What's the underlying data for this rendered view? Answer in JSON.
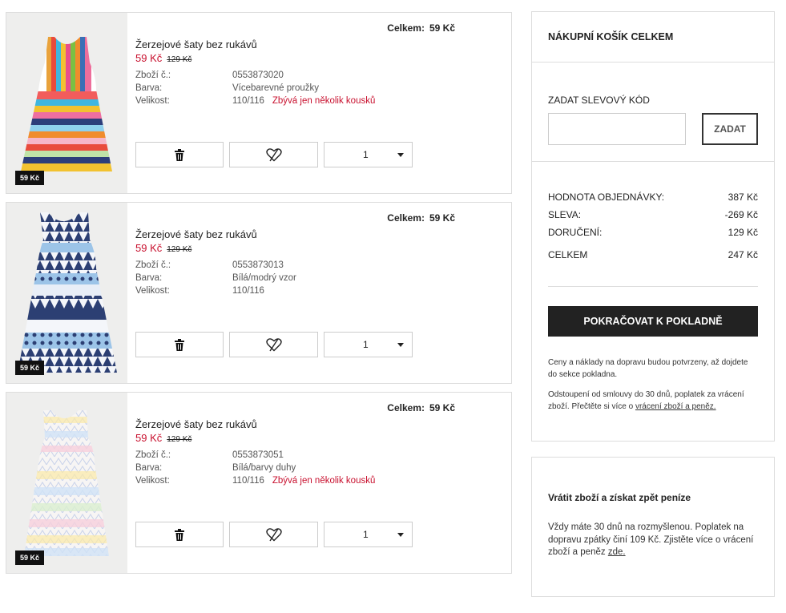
{
  "cart_items": [
    {
      "name": "Žerzejové šaty bez rukávů",
      "price": "59 Kč",
      "old_price": "129 Kč",
      "total_label": "Celkem:",
      "total_value": "59 Kč",
      "tag_price": "59 Kč",
      "article_label": "Zboží č.:",
      "article_value": "0553873020",
      "color_label": "Barva:",
      "color_value": "Vícebarevné proužky",
      "size_label": "Velikost:",
      "size_value": "110/116",
      "stock_warning": "Zbývá jen několik kousků",
      "quantity": "1"
    },
    {
      "name": "Žerzejové šaty bez rukávů",
      "price": "59 Kč",
      "old_price": "129 Kč",
      "total_label": "Celkem:",
      "total_value": "59 Kč",
      "tag_price": "59 Kč",
      "article_label": "Zboží č.:",
      "article_value": "0553873013",
      "color_label": "Barva:",
      "color_value": "Bílá/modrý vzor",
      "size_label": "Velikost:",
      "size_value": "110/116",
      "stock_warning": "",
      "quantity": "1"
    },
    {
      "name": "Žerzejové šaty bez rukávů",
      "price": "59 Kč",
      "old_price": "129 Kč",
      "total_label": "Celkem:",
      "total_value": "59 Kč",
      "tag_price": "59 Kč",
      "article_label": "Zboží č.:",
      "article_value": "0553873051",
      "color_label": "Barva:",
      "color_value": "Bílá/barvy duhy",
      "size_label": "Velikost:",
      "size_value": "110/116",
      "stock_warning": "Zbývá jen několik kousků",
      "quantity": "1"
    }
  ],
  "summary": {
    "title": "NÁKUPNÍ KOŠÍK CELKEM",
    "discount_label": "ZADAT SLEVOVÝ KÓD",
    "discount_placeholder": "",
    "discount_button": "ZADAT",
    "order_value_label": "HODNOTA OBJEDNÁVKY:",
    "order_value": "387 Kč",
    "discount_row_label": "SLEVA:",
    "discount_row_value": "-269 Kč",
    "delivery_label": "DORUČENÍ:",
    "delivery_value": "129 Kč",
    "total_label": "CELKEM",
    "total_value": "247 Kč",
    "checkout_button": "POKRAČOVAT K POKLADNĚ",
    "note1": "Ceny a náklady na dopravu budou potvrzeny, až dojdete do sekce pokladna.",
    "note2_text": "Odstoupení od smlouvy do 30 dnů, poplatek za vrácení zboží. Přečtěte si více o",
    "note2_link": "vrácení zboží a peněz."
  },
  "returns": {
    "title": "Vrátit zboží a získat zpět peníze",
    "text": "Vždy máte 30 dnů na rozmyšlenou. Poplatek na dopravu zpátky činí 109 Kč. Zjistěte více o vrácení zboží a peněz",
    "link": "zde."
  },
  "colors": {
    "sale_red": "#c8102e",
    "dark": "#222222",
    "border": "#dddddd"
  }
}
